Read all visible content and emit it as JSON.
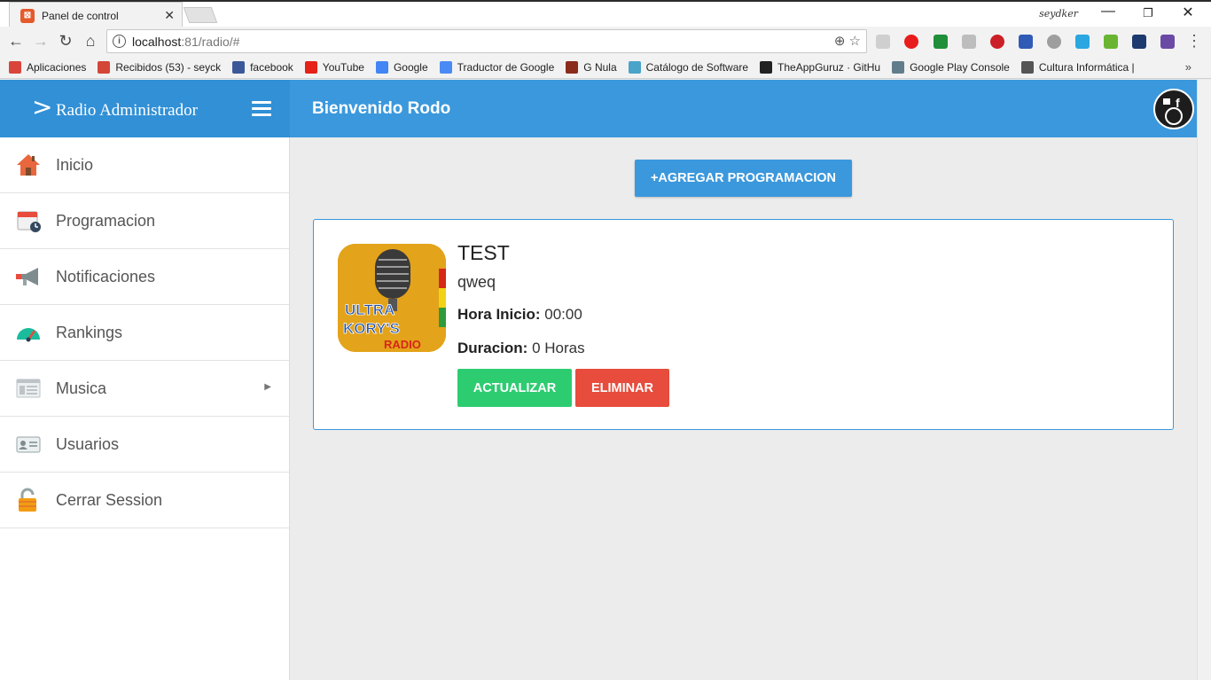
{
  "browser": {
    "tab_title": "Panel de control",
    "profile_name": "seydker",
    "url_host": "localhost",
    "url_path": ":81/radio/#",
    "bookmarks": [
      {
        "label": "Aplicaciones",
        "icon": "apps-grid-icon",
        "color": "#d9453a"
      },
      {
        "label": "Recibidos (53) - seyck",
        "icon": "gmail-icon",
        "color": "#d44638"
      },
      {
        "label": "facebook",
        "icon": "facebook-icon",
        "color": "#3b5998"
      },
      {
        "label": "YouTube",
        "icon": "youtube-icon",
        "color": "#e62117"
      },
      {
        "label": "Google",
        "icon": "google-icon",
        "color": "#4285f4"
      },
      {
        "label": "Traductor de Google",
        "icon": "translate-icon",
        "color": "#4a8af4"
      },
      {
        "label": "G Nula",
        "icon": "gnula-icon",
        "color": "#8a2b1c"
      },
      {
        "label": "Catálogo de Software",
        "icon": "catalog-icon",
        "color": "#4aa3c8"
      },
      {
        "label": "TheAppGuruz · GitHu",
        "icon": "github-icon",
        "color": "#222222"
      },
      {
        "label": "Google Play Console",
        "icon": "play-icon",
        "color": "#607d8b"
      },
      {
        "label": "Cultura Informática |",
        "icon": "cultura-icon",
        "color": "#555555"
      }
    ],
    "bookmarks_more": "»"
  },
  "app": {
    "brand_chevron": ">",
    "brand": "Radio Administrador",
    "welcome": "Bienvenido Rodo",
    "accent_color": "#3b98dc"
  },
  "sidebar": {
    "items": [
      {
        "label": "Inicio",
        "icon": "home-icon"
      },
      {
        "label": "Programacion",
        "icon": "calendar-icon"
      },
      {
        "label": "Notificaciones",
        "icon": "megaphone-icon"
      },
      {
        "label": "Rankings",
        "icon": "speedometer-icon"
      },
      {
        "label": "Musica",
        "icon": "list-icon",
        "has_submenu": true
      },
      {
        "label": "Usuarios",
        "icon": "id-card-icon"
      },
      {
        "label": "Cerrar Session",
        "icon": "padlock-icon"
      }
    ]
  },
  "main": {
    "add_button": "+AGREGAR PROGRAMACION",
    "program": {
      "title": "TEST",
      "description": "qweq",
      "start_label": "Hora Inicio:",
      "start_value": "00:00",
      "duration_label": "Duracion:",
      "duration_value": "0 Horas",
      "update_button": "ACTUALIZAR",
      "delete_button": "ELIMINAR",
      "logo_text_1": "ULTRA",
      "logo_text_2": "KORY'S",
      "logo_text_3": "RADIO"
    }
  }
}
